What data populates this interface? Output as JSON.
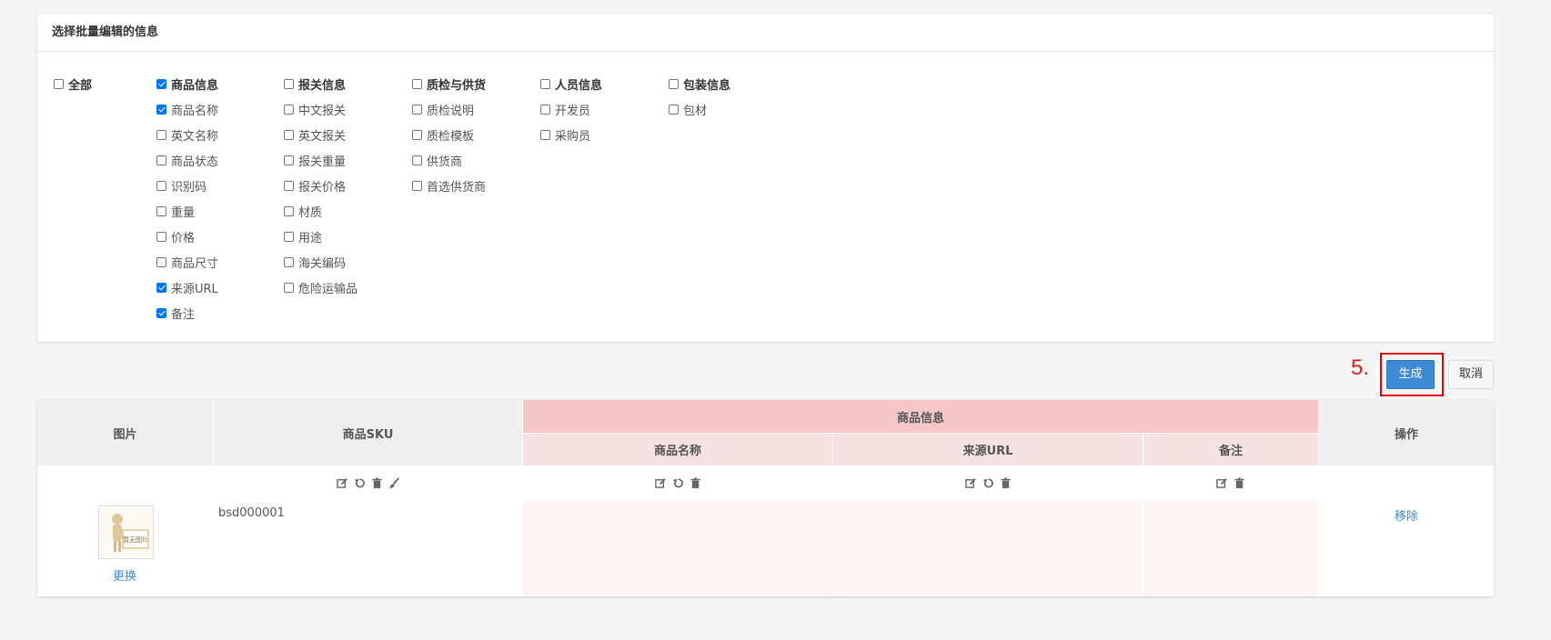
{
  "panel": {
    "title": "选择批量编辑的信息",
    "all_label": "全部",
    "all_checked": false,
    "groups": [
      {
        "title": "商品信息",
        "checked": true,
        "items": [
          {
            "label": "商品名称",
            "checked": true
          },
          {
            "label": "英文名称",
            "checked": false
          },
          {
            "label": "商品状态",
            "checked": false
          },
          {
            "label": "识别码",
            "checked": false
          },
          {
            "label": "重量",
            "checked": false
          },
          {
            "label": "价格",
            "checked": false
          },
          {
            "label": "商品尺寸",
            "checked": false
          },
          {
            "label": "来源URL",
            "checked": true
          },
          {
            "label": "备注",
            "checked": true
          }
        ]
      },
      {
        "title": "报关信息",
        "checked": false,
        "items": [
          {
            "label": "中文报关",
            "checked": false
          },
          {
            "label": "英文报关",
            "checked": false
          },
          {
            "label": "报关重量",
            "checked": false
          },
          {
            "label": "报关价格",
            "checked": false
          },
          {
            "label": "材质",
            "checked": false
          },
          {
            "label": "用途",
            "checked": false
          },
          {
            "label": "海关编码",
            "checked": false
          },
          {
            "label": "危险运输品",
            "checked": false
          }
        ]
      },
      {
        "title": "质检与供货",
        "checked": false,
        "items": [
          {
            "label": "质检说明",
            "checked": false
          },
          {
            "label": "质检模板",
            "checked": false
          },
          {
            "label": "供货商",
            "checked": false
          },
          {
            "label": "首选供货商",
            "checked": false
          }
        ]
      },
      {
        "title": "人员信息",
        "checked": false,
        "items": [
          {
            "label": "开发员",
            "checked": false
          },
          {
            "label": "采购员",
            "checked": false
          }
        ]
      },
      {
        "title": "包装信息",
        "checked": false,
        "items": [
          {
            "label": "包材",
            "checked": false
          }
        ]
      }
    ]
  },
  "annotation": {
    "step": "5."
  },
  "buttons": {
    "generate": "生成",
    "cancel": "取消"
  },
  "table": {
    "headers": {
      "image": "图片",
      "sku": "商品SKU",
      "group": "商品信息",
      "name": "商品名称",
      "url": "来源URL",
      "note": "备注",
      "action": "操作"
    },
    "rows": [
      {
        "sku": "bsd000001",
        "image_text": "暂无图片",
        "replace": "更换",
        "remove": "移除"
      }
    ]
  }
}
